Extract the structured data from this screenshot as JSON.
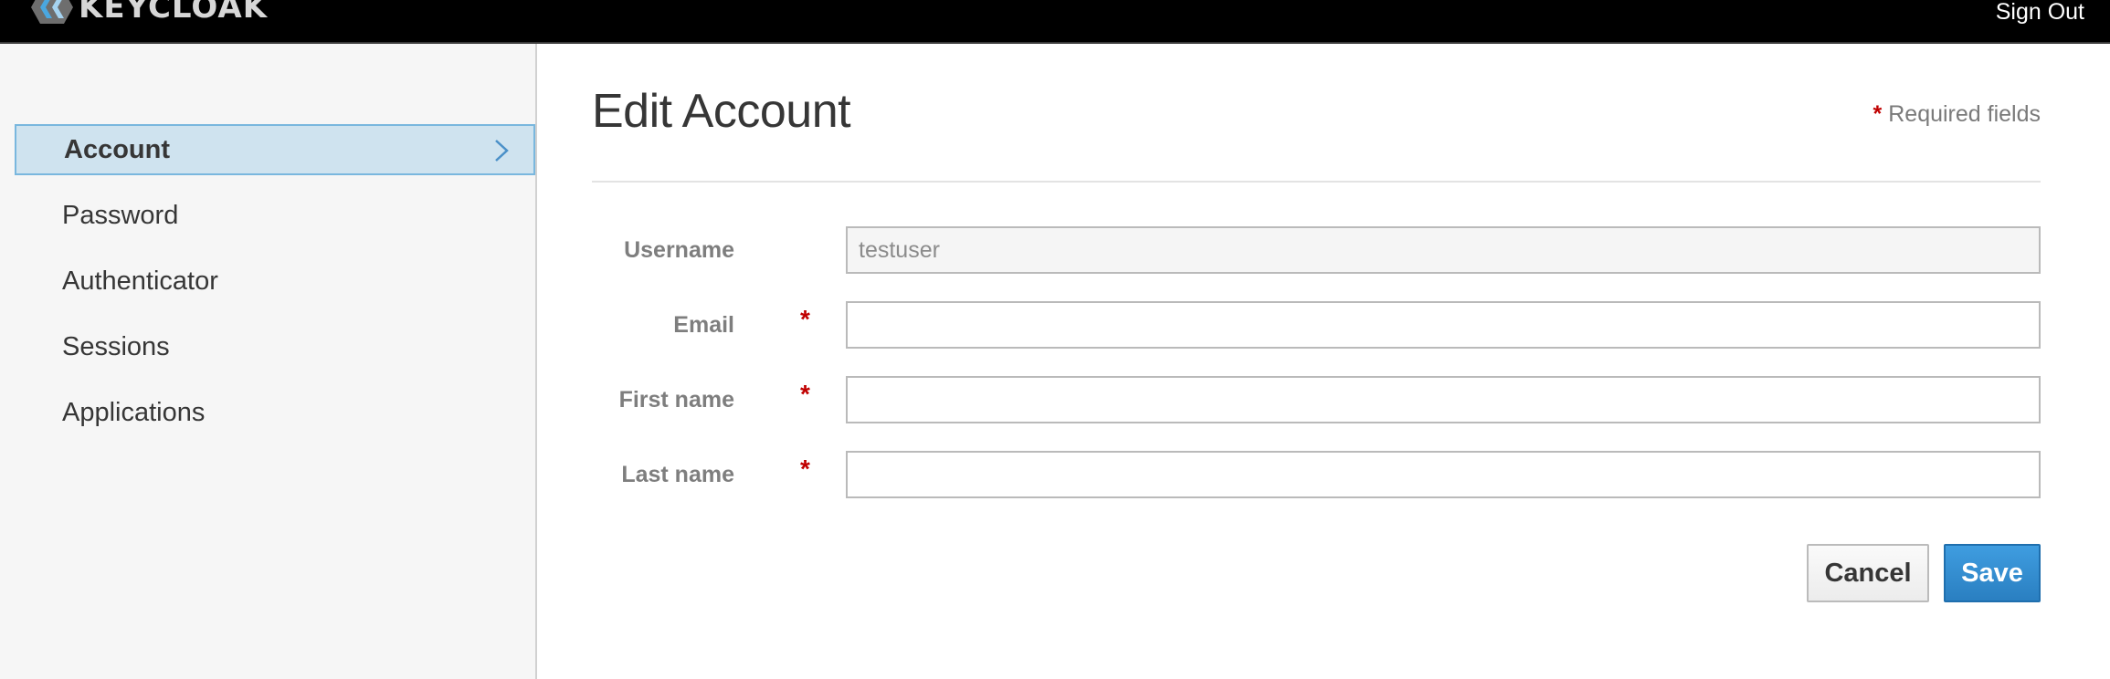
{
  "header": {
    "brand": "KEYCLOAK",
    "sign_out_label": "Sign Out"
  },
  "sidebar": {
    "items": [
      {
        "label": "Account",
        "active": true,
        "icon": "chevron-right-icon"
      },
      {
        "label": "Password",
        "active": false
      },
      {
        "label": "Authenticator",
        "active": false
      },
      {
        "label": "Sessions",
        "active": false
      },
      {
        "label": "Applications",
        "active": false
      }
    ]
  },
  "main": {
    "title": "Edit Account",
    "required_star": "*",
    "required_note": "Required fields",
    "fields": {
      "username": {
        "label": "Username",
        "value": "testuser",
        "required": false,
        "readonly": true
      },
      "email": {
        "label": "Email",
        "value": "",
        "required": true
      },
      "first_name": {
        "label": "First name",
        "value": "",
        "required": true
      },
      "last_name": {
        "label": "Last name",
        "value": "",
        "required": true
      }
    },
    "required_marker": "*",
    "buttons": {
      "cancel_label": "Cancel",
      "save_label": "Save"
    }
  },
  "colors": {
    "header_bg": "#000000",
    "sidebar_bg": "#f6f6f6",
    "active_item_bg": "#cfe3ef",
    "active_item_border": "#79b7de",
    "required_star": "#c00000",
    "primary_button": "#2a7fc1"
  }
}
